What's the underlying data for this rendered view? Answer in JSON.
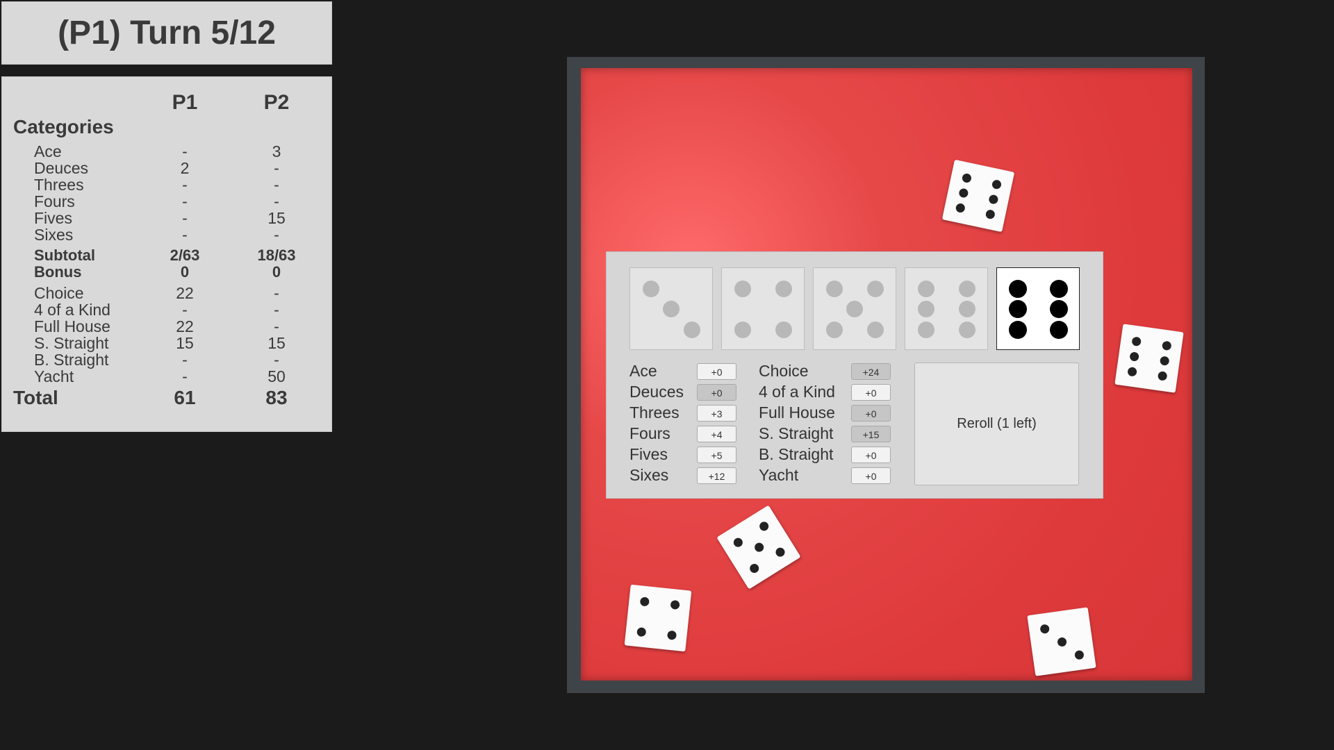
{
  "turn": {
    "title": "(P1) Turn 5/12"
  },
  "scoreboard": {
    "players": [
      "P1",
      "P2"
    ],
    "categories_label": "Categories",
    "upper": [
      {
        "label": "Ace",
        "p1": "-",
        "p2": "3"
      },
      {
        "label": "Deuces",
        "p1": "2",
        "p2": "-"
      },
      {
        "label": "Threes",
        "p1": "-",
        "p2": "-"
      },
      {
        "label": "Fours",
        "p1": "-",
        "p2": "-"
      },
      {
        "label": "Fives",
        "p1": "-",
        "p2": "15"
      },
      {
        "label": "Sixes",
        "p1": "-",
        "p2": "-"
      }
    ],
    "subtotal": {
      "label": "Subtotal",
      "p1": "2/63",
      "p2": "18/63"
    },
    "bonus": {
      "label": "Bonus",
      "p1": "0",
      "p2": "0"
    },
    "lower": [
      {
        "label": "Choice",
        "p1": "22",
        "p2": "-"
      },
      {
        "label": "4 of a Kind",
        "p1": "-",
        "p2": "-"
      },
      {
        "label": "Full House",
        "p1": "22",
        "p2": "-"
      },
      {
        "label": "S. Straight",
        "p1": "15",
        "p2": "15"
      },
      {
        "label": "B. Straight",
        "p1": "-",
        "p2": "-"
      },
      {
        "label": "Yacht",
        "p1": "-",
        "p2": "50"
      }
    ],
    "total": {
      "label": "Total",
      "p1": "61",
      "p2": "83"
    }
  },
  "held_dice": [
    {
      "value": 3,
      "held": false
    },
    {
      "value": 4,
      "held": false
    },
    {
      "value": 5,
      "held": false
    },
    {
      "value": 6,
      "held": false
    },
    {
      "value": 6,
      "held": true
    }
  ],
  "board_dice": [
    {
      "value": 6,
      "tilt": 12
    },
    {
      "value": 6,
      "tilt": 8
    },
    {
      "value": 5,
      "tilt": -32
    },
    {
      "value": 4,
      "tilt": 6
    },
    {
      "value": 3,
      "tilt": -8
    }
  ],
  "score_options": {
    "left": [
      {
        "label": "Ace",
        "points": "+0",
        "disabled": false
      },
      {
        "label": "Deuces",
        "points": "+0",
        "disabled": true
      },
      {
        "label": "Threes",
        "points": "+3",
        "disabled": false
      },
      {
        "label": "Fours",
        "points": "+4",
        "disabled": false
      },
      {
        "label": "Fives",
        "points": "+5",
        "disabled": false
      },
      {
        "label": "Sixes",
        "points": "+12",
        "disabled": false
      }
    ],
    "right": [
      {
        "label": "Choice",
        "points": "+24",
        "disabled": true
      },
      {
        "label": "4 of a Kind",
        "points": "+0",
        "disabled": false
      },
      {
        "label": "Full House",
        "points": "+0",
        "disabled": true
      },
      {
        "label": "S. Straight",
        "points": "+15",
        "disabled": true
      },
      {
        "label": "B. Straight",
        "points": "+0",
        "disabled": false
      },
      {
        "label": "Yacht",
        "points": "+0",
        "disabled": false
      }
    ]
  },
  "reroll": {
    "label": "Reroll (1 left)"
  }
}
